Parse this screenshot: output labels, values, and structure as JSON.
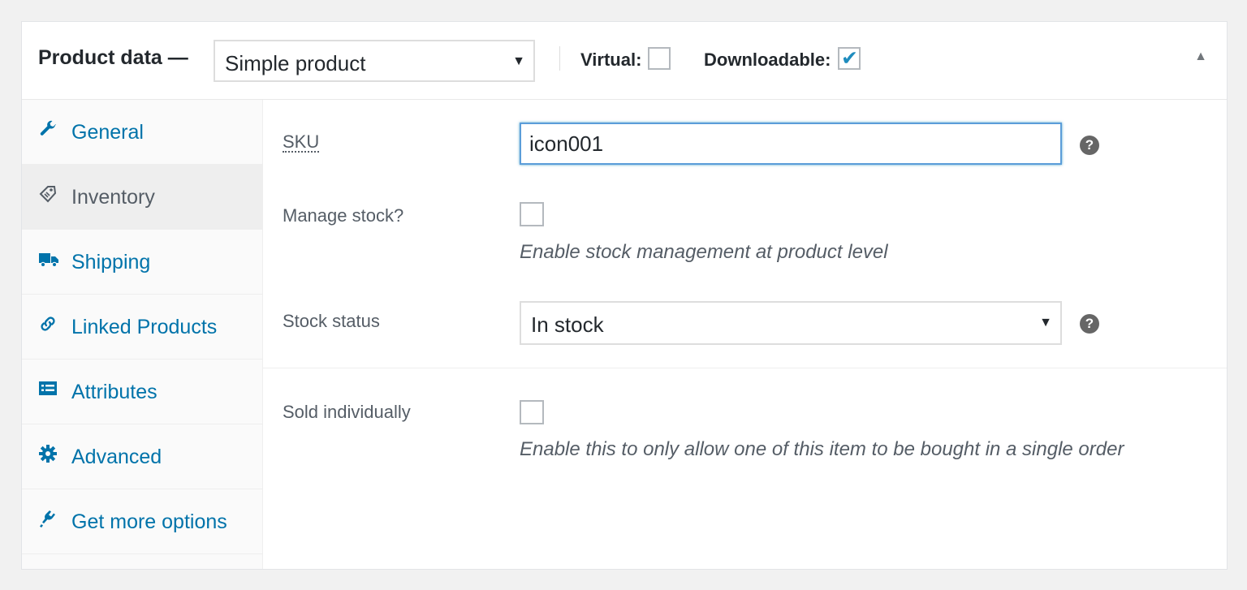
{
  "header": {
    "title": "Product data —",
    "product_type": "Simple product",
    "virtual_label": "Virtual:",
    "virtual_checked": false,
    "downloadable_label": "Downloadable:",
    "downloadable_checked": true
  },
  "tabs": [
    {
      "label": "General",
      "icon": "wrench-icon",
      "active": false
    },
    {
      "label": "Inventory",
      "icon": "tag-icon",
      "active": true
    },
    {
      "label": "Shipping",
      "icon": "truck-icon",
      "active": false
    },
    {
      "label": "Linked Products",
      "icon": "link-icon",
      "active": false
    },
    {
      "label": "Attributes",
      "icon": "list-icon",
      "active": false
    },
    {
      "label": "Advanced",
      "icon": "gear-icon",
      "active": false
    },
    {
      "label": "Get more options",
      "icon": "plugin-icon",
      "active": false
    }
  ],
  "inventory": {
    "sku_label": "SKU",
    "sku_value": "icon001",
    "manage_stock_label": "Manage stock?",
    "manage_stock_checked": false,
    "manage_stock_desc": "Enable stock management at product level",
    "stock_status_label": "Stock status",
    "stock_status_value": "In stock",
    "sold_individually_label": "Sold individually",
    "sold_individually_checked": false,
    "sold_individually_desc": "Enable this to only allow one of this item to be bought in a single order",
    "help_glyph": "?"
  },
  "colors": {
    "link": "#0073aa",
    "active_tab_text": "#555d66",
    "focus_border": "#5b9dd9",
    "check": "#1e8cbe"
  }
}
